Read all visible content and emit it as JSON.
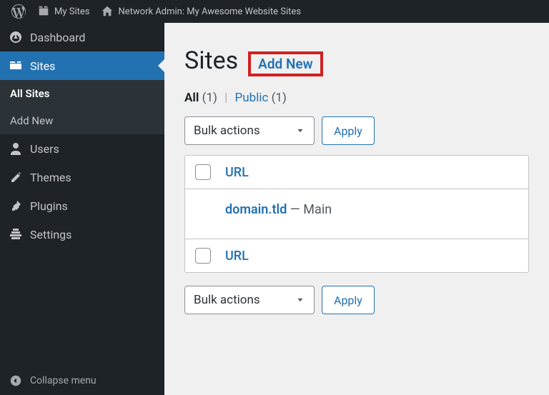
{
  "admin_bar": {
    "my_sites": "My Sites",
    "network_admin": "Network Admin: My Awesome Website Sites"
  },
  "sidebar": {
    "items": [
      {
        "label": "Dashboard"
      },
      {
        "label": "Sites"
      },
      {
        "label": "Users"
      },
      {
        "label": "Themes"
      },
      {
        "label": "Plugins"
      },
      {
        "label": "Settings"
      }
    ],
    "submenu": [
      {
        "label": "All Sites"
      },
      {
        "label": "Add New"
      }
    ],
    "collapse": "Collapse menu"
  },
  "page": {
    "title": "Sites",
    "add_new": "Add New"
  },
  "filters": {
    "all_label": "All",
    "all_count": "(1)",
    "public_label": "Public",
    "public_count": "(1)"
  },
  "bulk": {
    "label": "Bulk actions",
    "apply": "Apply"
  },
  "table": {
    "url_header": "URL",
    "rows": [
      {
        "domain": "domain.tld",
        "suffix": " — Main"
      }
    ],
    "url_footer": "URL"
  }
}
